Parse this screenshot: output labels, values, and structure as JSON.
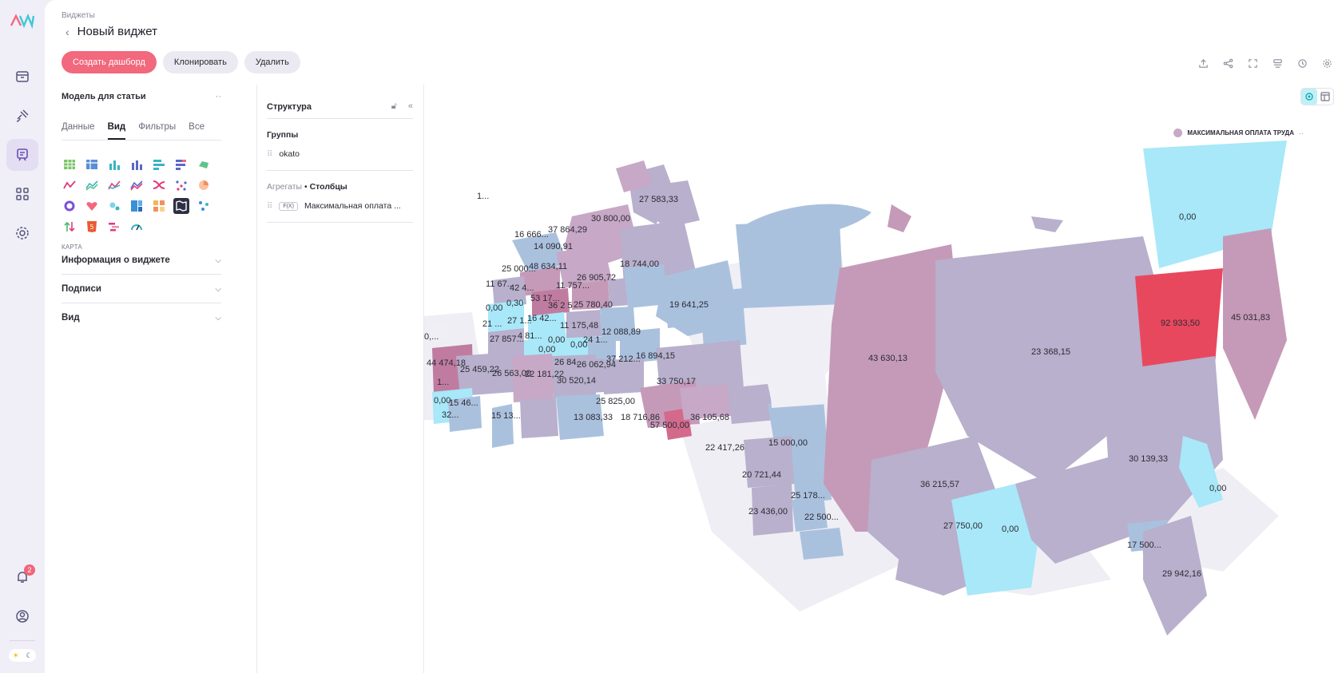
{
  "app": {
    "breadcrumb": "Виджеты",
    "title": "Новый виджет"
  },
  "actions": {
    "create": "Создать дашборд",
    "clone": "Клонировать",
    "delete": "Удалить"
  },
  "toolbar_icons": [
    "export-icon",
    "share-icon",
    "fullscreen-icon",
    "filter-settings-icon",
    "history-icon",
    "gear-icon"
  ],
  "rail": {
    "items": [
      "inbox-icon",
      "satellite-icon",
      "widgets-icon",
      "apps-icon",
      "gear-icon"
    ],
    "notification_count": "2"
  },
  "panel": {
    "model": "Модель для статьи",
    "model_menu": "··",
    "tabs": [
      "Данные",
      "Вид",
      "Фильтры",
      "Все"
    ],
    "active_tab": "Вид",
    "chart_type_section": "КАРТА",
    "accordions": [
      "Информация о виджете",
      "Подписи",
      "Вид"
    ]
  },
  "structure": {
    "title": "Структура",
    "groups_label": "Группы",
    "group_field": "okato",
    "agg_prefix": "Агрегаты",
    "agg_sep": " • ",
    "agg_bold": "Столбцы",
    "fx": "F(X)",
    "agg_field": "Максимальная оплата ..."
  },
  "legend": {
    "label": "МАКСИМАЛЬНАЯ ОПЛАТА ТРУДА",
    "menu": "··"
  },
  "colors": {
    "accent": "#f2687d",
    "zero": "#a8e8f8",
    "low": "#a9c0dc",
    "mid": "#b8b0cc",
    "high": "#c59ab8",
    "max": "#e8485e",
    "none": "#f0eff5"
  },
  "map_labels": [
    "1...",
    "27 583,33",
    "30 800,00",
    "16 666...",
    "37 864,29",
    "14 090,91",
    "25 000...",
    "48 634,11",
    "18 744,00",
    "11 67...",
    "42 4...",
    "26 905,72",
    "11 757...",
    "0,00",
    "0,30",
    "53 17...",
    "36 2 5",
    "25 780,40",
    "19 641,25",
    "21 ...",
    "27 1...",
    "16 42...",
    "11 175,48",
    "12 088,89",
    "27 857...",
    "4 81...",
    "0,00",
    "0,00",
    "0,00",
    "24 1...",
    "37 212...",
    "16 894,15",
    "0,...",
    "44 474,18",
    "25 459,22",
    "26 563,00",
    "22 181,22",
    "26 84...",
    "26 062,94",
    "30 520,14",
    "33 750,17",
    "1...",
    "0,00",
    "15 46...",
    "32...",
    "15 13...",
    "25 825,00",
    "18 716,86",
    "13 083,33",
    "57 500,00",
    "36 105,68",
    "22 417,26",
    "15 000,00",
    "20 721,44",
    "25 178...",
    "23 436,00",
    "22 500...",
    "43 630,13",
    "23 368,15",
    "0,00",
    "92 933,50",
    "45 031,83",
    "36 215,57",
    "27 750,00",
    "0,00",
    "30 139,33",
    "0,00",
    "17 500...",
    "29 942,16"
  ]
}
